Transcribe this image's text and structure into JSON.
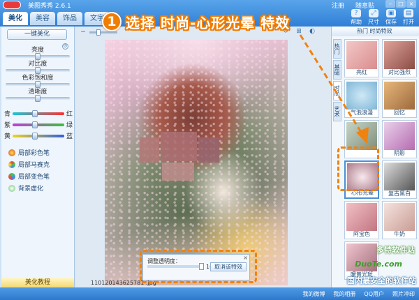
{
  "app": {
    "title": "美图秀秀 2.6.1"
  },
  "top_links": [
    "注册",
    "随意贴"
  ],
  "tabs": [
    "美化",
    "美容",
    "饰品",
    "文字"
  ],
  "toolbar": [
    {
      "label": "帮助",
      "icon": "help-icon"
    },
    {
      "label": "尺寸",
      "icon": "resize-icon"
    },
    {
      "label": "保存",
      "icon": "save-icon"
    },
    {
      "label": "打开",
      "icon": "open-icon"
    }
  ],
  "banner": {
    "step": "1",
    "text": "选择 时尚-心形光晕 特效"
  },
  "left": {
    "auto_button": "一键美化",
    "adjust": [
      "亮度",
      "对比度",
      "色彩饱和度",
      "清晰度"
    ],
    "color_rows": [
      {
        "left": "青",
        "right": "红"
      },
      {
        "left": "紫",
        "right": "绿"
      },
      {
        "left": "黄",
        "right": "蓝"
      }
    ],
    "menu": [
      "局部彩色笔",
      "局部马赛克",
      "局部变色笔",
      "背景虚化"
    ],
    "tutorial": "美化教程"
  },
  "canvas": {
    "filename": "110120143625781 .jpg",
    "opacity_label": "调整透明度：",
    "opacity_value": "100%",
    "opacity_percent": 100,
    "cancel_effect": "取消该特效"
  },
  "right": {
    "header": "热门  时尚特效",
    "vtabs": [
      "热门",
      "基础",
      "时尚",
      "艺术"
    ],
    "effects": [
      "亮红",
      "对比强烈",
      "气泡浪漫",
      "回忆",
      "",
      "阴影",
      "心形光晕",
      "复古黑白",
      "阿宝色",
      "牛奶",
      "暖黄光斑",
      ""
    ],
    "selected": "心形光晕"
  },
  "watermark": {
    "title": "多特软件站",
    "url": "DuoTe.com",
    "sub": "国内最安全的软件站"
  },
  "statusbar": [
    "我的微博",
    "我的相册",
    "QQ用户",
    "照片冲印"
  ]
}
